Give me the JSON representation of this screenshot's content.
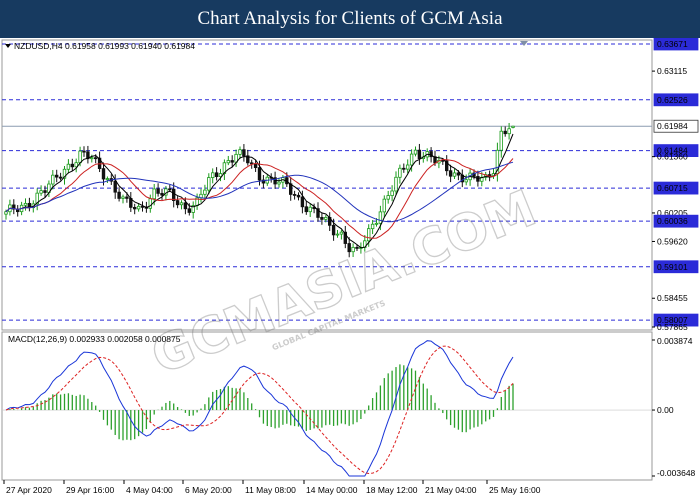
{
  "banner": {
    "title": "Chart Analysis for Clients of GCM Asia"
  },
  "watermark": {
    "main": "GCMASIA.COM",
    "sub": "GLOBAL CAPITAL MARKETS"
  },
  "colors": {
    "banner_bg": "#173a60",
    "bull": "#1a9b1a",
    "bear": "#111111",
    "fast_ma": "#000000",
    "mid_ma": "#cc2222",
    "slow_ma": "#2233bb",
    "level_line": "#2b2bd8",
    "macd_line": "#1a36d8",
    "signal_line": "#dd2222",
    "hist": "#2ca02c"
  },
  "chart_data": [
    {
      "type": "candlestick",
      "header": "NZDUSD,H4  0.61958 0.61993 0.61940 0.61984",
      "symbol": "NZDUSD",
      "timeframe": "H4",
      "ohlc_last": {
        "open": 0.61958,
        "high": 0.61993,
        "low": 0.6194,
        "close": 0.61984
      },
      "ylim": [
        0.57865,
        0.63671
      ],
      "y_ticks": [
        "0.63671",
        "0.63115",
        "0.62526",
        "0.61984",
        "0.61484",
        "0.61360",
        "0.60715",
        "0.60205",
        "0.60036",
        "0.59620",
        "0.59101",
        "0.58455",
        "0.58007",
        "0.57865"
      ],
      "levels": [
        0.63671,
        0.62526,
        0.61484,
        0.60715,
        0.60036,
        0.59101,
        0.58007
      ],
      "current_price": 0.61984,
      "x_labels": [
        "27 Apr 2020",
        "29 Apr 16:00",
        "4 May 04:00",
        "6 May 20:00",
        "11 May 08:00",
        "14 May 00:00",
        "18 May 12:00",
        "21 May 04:00",
        "25 May 16:00"
      ],
      "moving_averages": [
        "fast",
        "mid",
        "slow"
      ],
      "grid": false
    },
    {
      "type": "macd",
      "header": "MACD(12,26,9) 0.002933 0.002058 0.000875",
      "params": [
        12,
        26,
        9
      ],
      "values": {
        "macd": 0.002933,
        "signal": 0.002058,
        "histogram": 0.000875
      },
      "ylim": [
        -0.003648,
        0.003874
      ],
      "y_ticks": [
        "0.003874",
        "0.00",
        "-0.003648"
      ]
    }
  ]
}
